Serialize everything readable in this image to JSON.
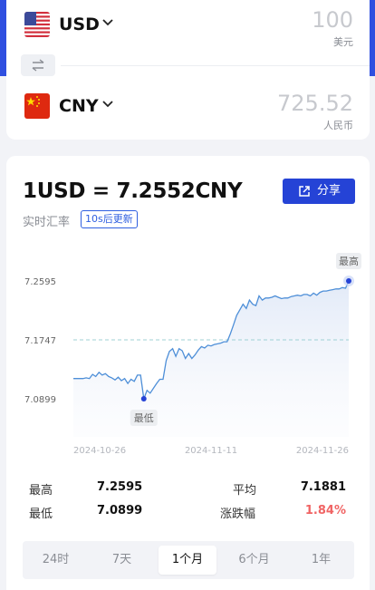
{
  "colors": {
    "accent": "#2543d6",
    "line": "#4e8fd8",
    "avg_line": "#9fd0d6",
    "negative": "#f06464"
  },
  "converter": {
    "from": {
      "code": "USD",
      "amount": "100",
      "unit": "美元",
      "flag_icon": "us-flag-icon"
    },
    "swap_icon": "swap-icon",
    "to": {
      "code": "CNY",
      "amount": "725.52",
      "unit": "人民币",
      "flag_icon": "cn-flag-icon"
    }
  },
  "rate": {
    "title": "1USD = 7.2552CNY",
    "subtitle": "实时汇率",
    "refresh_badge": "10s后更新",
    "share_label": "分享"
  },
  "chart_data": {
    "type": "line",
    "x_ticks": [
      "2024-10-26",
      "2024-11-11",
      "2024-11-26"
    ],
    "y_ticks": [
      7.2595,
      7.1747,
      7.0899
    ],
    "ylim": [
      7.0899,
      7.2595
    ],
    "average": 7.1747,
    "max_label": "最高",
    "min_label": "最低",
    "max_point": {
      "index": 86,
      "value": 7.2595
    },
    "min_point": {
      "index": 22,
      "value": 7.0899
    },
    "series": [
      {
        "values": [
          7.119,
          7.119,
          7.119,
          7.119,
          7.12,
          7.119,
          7.125,
          7.122,
          7.128,
          7.124,
          7.126,
          7.122,
          7.12,
          7.117,
          7.121,
          7.116,
          7.119,
          7.112,
          7.118,
          7.115,
          7.124,
          7.124,
          7.0899,
          7.102,
          7.098,
          7.105,
          7.112,
          7.118,
          7.118,
          7.145,
          7.158,
          7.162,
          7.151,
          7.162,
          7.159,
          7.148,
          7.155,
          7.148,
          7.153,
          7.16,
          7.165,
          7.163,
          7.167,
          7.166,
          7.168,
          7.169,
          7.17,
          7.172,
          7.172,
          7.183,
          7.196,
          7.21,
          7.218,
          7.226,
          7.22,
          7.232,
          7.226,
          7.224,
          7.238,
          7.232,
          7.235,
          7.235,
          7.236,
          7.238,
          7.236,
          7.234,
          7.235,
          7.235,
          7.237,
          7.238,
          7.239,
          7.238,
          7.24,
          7.24,
          7.238,
          7.242,
          7.239,
          7.243,
          7.245,
          7.245,
          7.246,
          7.247,
          7.248,
          7.248,
          7.25,
          7.249,
          7.2595
        ]
      }
    ]
  },
  "stats": {
    "high_label": "最高",
    "high": "7.2595",
    "avg_label": "平均",
    "avg": "7.1881",
    "low_label": "最低",
    "low": "7.0899",
    "change_label": "涨跌幅",
    "change": "1.84%"
  },
  "range_tabs": [
    {
      "label": "24时",
      "active": false
    },
    {
      "label": "7天",
      "active": false
    },
    {
      "label": "1个月",
      "active": true
    },
    {
      "label": "6个月",
      "active": false
    },
    {
      "label": "1年",
      "active": false
    }
  ]
}
